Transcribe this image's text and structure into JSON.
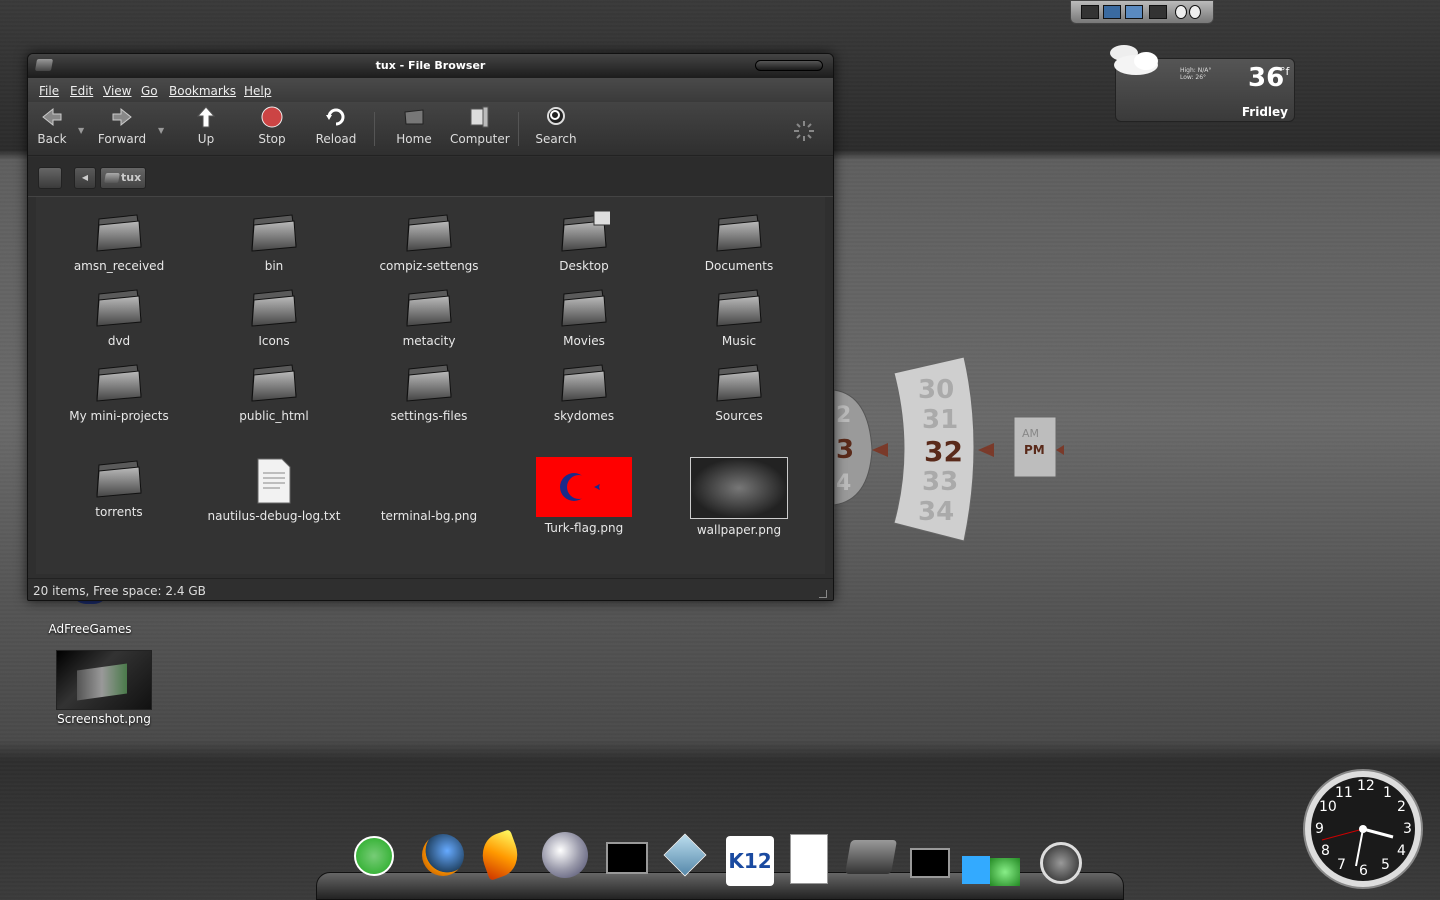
{
  "window": {
    "title": "tux - File Browser"
  },
  "menubar": {
    "items": [
      "File",
      "Edit",
      "View",
      "Go",
      "Bookmarks",
      "Help"
    ]
  },
  "toolbar": {
    "back": "Back",
    "forward": "Forward",
    "up": "Up",
    "stop": "Stop",
    "reload": "Reload",
    "home": "Home",
    "computer": "Computer",
    "search": "Search"
  },
  "location": {
    "crumb": "tux"
  },
  "files": [
    {
      "name": "amsn_received",
      "type": "folder"
    },
    {
      "name": "bin",
      "type": "folder"
    },
    {
      "name": "compiz-settengs",
      "type": "folder"
    },
    {
      "name": "Desktop",
      "type": "folder-desktop"
    },
    {
      "name": "Documents",
      "type": "folder"
    },
    {
      "name": "dvd",
      "type": "folder"
    },
    {
      "name": "Icons",
      "type": "folder"
    },
    {
      "name": "metacity",
      "type": "folder"
    },
    {
      "name": "Movies",
      "type": "folder"
    },
    {
      "name": "Music",
      "type": "folder"
    },
    {
      "name": "My mini-projects",
      "type": "folder"
    },
    {
      "name": "public_html",
      "type": "folder"
    },
    {
      "name": "settings-files",
      "type": "folder"
    },
    {
      "name": "skydomes",
      "type": "folder"
    },
    {
      "name": "Sources",
      "type": "folder"
    },
    {
      "name": "torrents",
      "type": "folder"
    },
    {
      "name": "nautilus-debug-log.txt",
      "type": "text"
    },
    {
      "name": "terminal-bg.png",
      "type": "image-dark"
    },
    {
      "name": "Turk-flag.png",
      "type": "image-flag"
    },
    {
      "name": "wallpaper.png",
      "type": "image-wallpaper"
    }
  ],
  "status": {
    "text": "20 items, Free space: 2.4 GB"
  },
  "desktop": {
    "icons": [
      {
        "label": "AdFreeGames"
      },
      {
        "label": "Screenshot.png"
      }
    ]
  },
  "weather": {
    "hilo": "High: N/A° Low: 26°",
    "temp": "36",
    "unit": "°f",
    "location": "Fridley"
  },
  "flip_clock": {
    "minutes": [
      "30",
      "31",
      "32",
      "33",
      "34"
    ],
    "hour_partial": [
      "2",
      "3",
      "4"
    ],
    "am": "AM",
    "pm": "PM"
  },
  "analog_clock": {
    "numbers": [
      "12",
      "1",
      "2",
      "3",
      "4",
      "5",
      "6",
      "7",
      "8",
      "9",
      "10",
      "11"
    ]
  },
  "dock": {
    "items": [
      "opensuse-icon",
      "firefox-icon",
      "flame-icon",
      "orb-icon",
      "terminal-icon",
      "virtualbox-icon",
      "k12-icon",
      "document-icon",
      "folder-icon",
      "terminal2-icon",
      "compiz-icon",
      "power-icon"
    ],
    "k12_label": "K12"
  }
}
